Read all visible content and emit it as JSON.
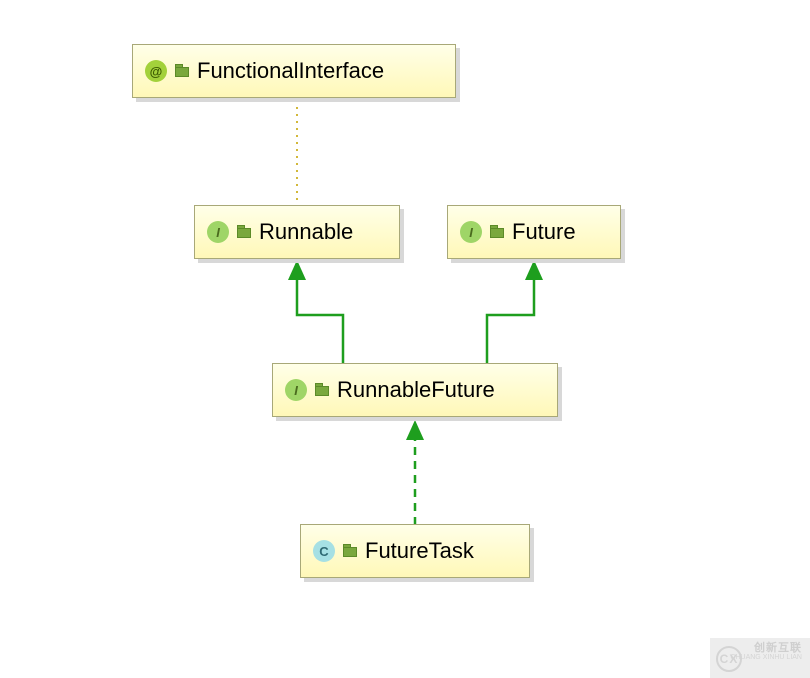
{
  "nodes": {
    "functionalInterface": {
      "label": "FunctionalInterface",
      "kind": "@"
    },
    "runnable": {
      "label": "Runnable",
      "kind": "I"
    },
    "future": {
      "label": "Future",
      "kind": "I"
    },
    "runnableFuture": {
      "label": "RunnableFuture",
      "kind": "I"
    },
    "futureTask": {
      "label": "FutureTask",
      "kind": "C"
    }
  },
  "watermark": {
    "logo_letters": "CX",
    "brand": "创新互联",
    "sub": "CHUANG XINHU LIAN"
  },
  "chart_data": {
    "type": "uml-class-diagram",
    "nodes": [
      {
        "id": "FunctionalInterface",
        "stereotype": "annotation"
      },
      {
        "id": "Runnable",
        "stereotype": "interface"
      },
      {
        "id": "Future",
        "stereotype": "interface"
      },
      {
        "id": "RunnableFuture",
        "stereotype": "interface"
      },
      {
        "id": "FutureTask",
        "stereotype": "class"
      }
    ],
    "edges": [
      {
        "from": "Runnable",
        "to": "FunctionalInterface",
        "relation": "annotated-by",
        "line": "dotted"
      },
      {
        "from": "RunnableFuture",
        "to": "Runnable",
        "relation": "extends",
        "line": "solid"
      },
      {
        "from": "RunnableFuture",
        "to": "Future",
        "relation": "extends",
        "line": "solid"
      },
      {
        "from": "FutureTask",
        "to": "RunnableFuture",
        "relation": "implements",
        "line": "dashed"
      }
    ]
  }
}
